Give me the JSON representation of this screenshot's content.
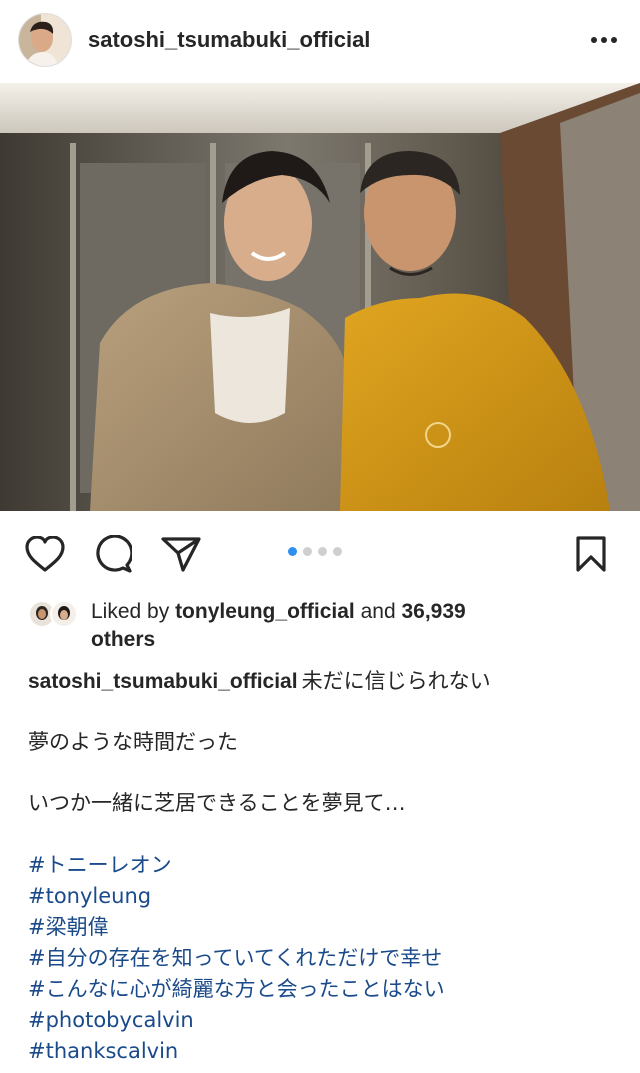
{
  "post": {
    "username": "satoshi_tsumabuki_official",
    "photo_alt": "",
    "carousel": {
      "count": 4,
      "active_index": 0
    }
  },
  "icons": {
    "more": "more-horizontal-icon",
    "like": "heart-icon",
    "comment": "comment-icon",
    "share": "send-icon",
    "save": "bookmark-icon"
  },
  "likes": {
    "prefix": "Liked by ",
    "user": "tonyleung_official",
    "middle": " and ",
    "count": "36,939",
    "suffix": " others"
  },
  "caption": {
    "username": "satoshi_tsumabuki_official",
    "lines": [
      "未だに信じられない",
      "夢のような時間だった",
      "いつか一緒に芝居できることを夢見て…"
    ],
    "hashtags": [
      "#トニーレオン",
      "#tonyleung",
      "#梁朝偉",
      "#自分の存在を知っていてくれただけで幸せ",
      "#こんなに心が綺麗な方と会ったことはない",
      "#photobycalvin",
      "#thankscalvin"
    ]
  },
  "colors": {
    "hashtag": "#1a4a8a",
    "active_dot": "#2f90ee",
    "inactive_dot": "#cfcfcf"
  }
}
